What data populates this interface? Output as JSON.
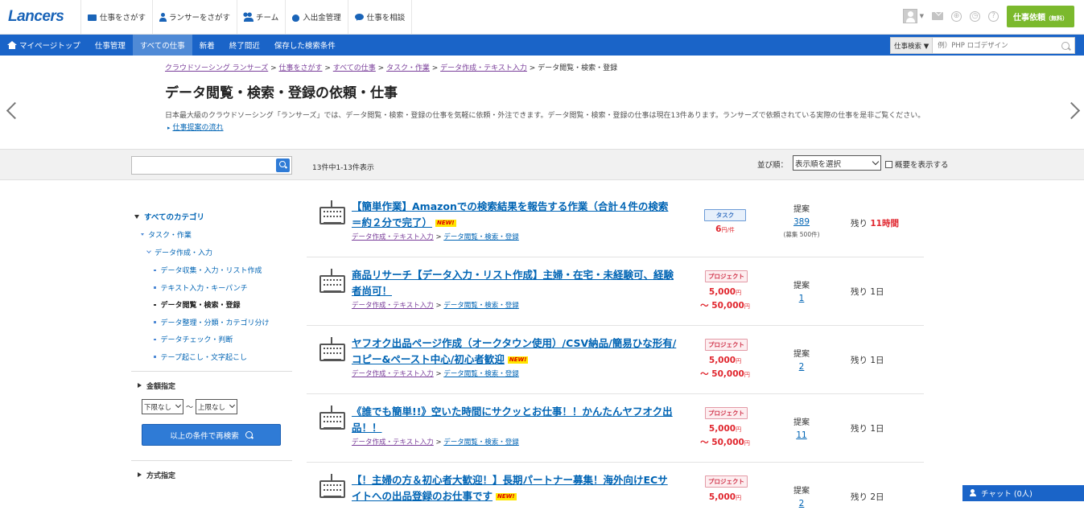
{
  "header": {
    "logo": "Lancers",
    "nav": [
      {
        "label": "仕事をさがす",
        "icon": "folder-icon"
      },
      {
        "label": "ランサーをさがす",
        "icon": "person-icon"
      },
      {
        "label": "チーム",
        "icon": "team-icon"
      },
      {
        "label": "入出金管理",
        "icon": "money-bag-icon"
      },
      {
        "label": "仕事を相談",
        "icon": "chat-bubble-icon"
      }
    ],
    "post_job_label": "仕事依頼",
    "post_job_sub": "（無料）"
  },
  "bluenav": {
    "items": [
      "マイページトップ",
      "仕事管理",
      "すべての仕事",
      "新着",
      "終了間近",
      "保存した検索条件"
    ],
    "search_category": "仕事検索 ▼",
    "search_placeholder": "例）PHP ロゴデザイン"
  },
  "page": {
    "breadcrumb": [
      "クラウドソーシング ランサーズ",
      "仕事をさがす",
      "すべての仕事",
      "タスク・作業",
      "データ作成・テキスト入力",
      "データ閲覧・検索・登録"
    ],
    "title": "データ閲覧・検索・登録の依頼・仕事",
    "description": "日本最大級のクラウドソーシング「ランサーズ」では、データ閲覧・検索・登録の仕事を気軽に依頼・外注できます。データ閲覧・検索・登録の仕事は現在13件あります。ランサーズで依頼されている実際の仕事を是非ご覧ください。",
    "flow_link": "仕事提案の流れ"
  },
  "filter": {
    "count_text": "13件中1-13件表示",
    "sort_label": "並び順：",
    "sort_value": "表示順を選択",
    "summary_label": "概要を表示する"
  },
  "sidebar": {
    "all_categories": "すべてのカテゴリ",
    "level1": "タスク・作業",
    "level2": "データ作成・入力",
    "level3": [
      "データ収集・入力・リスト作成",
      "テキスト入力・キーパンチ",
      "データ閲覧・検索・登録",
      "データ整理・分類・カテゴリ分け",
      "データチェック・判断",
      "テープ起こし・文字起こし"
    ],
    "amount_head": "金額指定",
    "min_value": "下限なし",
    "range_sep": "～",
    "max_value": "上限なし",
    "research_label": "以上の条件で再検索",
    "method_head": "方式指定"
  },
  "jobs": [
    {
      "title": "【簡単作業】Amazonでの検索結果を報告する作業（合計４件の検索＝約２分で完了）",
      "is_new": true,
      "cat1": "データ作成・テキスト入力",
      "cat2": "データ閲覧・検索・登録",
      "type": "タスク",
      "price1": "6",
      "price1_unit": "円/件",
      "price2": "",
      "price2_unit": "",
      "prop_label": "提案",
      "prop_count": "389",
      "prop_cap": "(募集 500件)",
      "remain_prefix": "残り",
      "remain_value": "11時間"
    },
    {
      "title": "商品リサーチ【データ入力・リスト作成】主婦・在宅・未経験可、経験者尚可！",
      "is_new": false,
      "cat1": "データ作成・テキスト入力",
      "cat2": "データ閲覧・検索・登録",
      "type": "プロジェクト",
      "price1": "5,000",
      "price1_unit": "円",
      "price2": "～ 50,000",
      "price2_unit": "円",
      "prop_label": "提案",
      "prop_count": "1",
      "prop_cap": "",
      "remain_prefix": "残り",
      "remain_value": "1日"
    },
    {
      "title": "ヤフオク出品ページ作成（オークタウン使用）/CSV納品/簡易ひな形有/コピー&ペースト中心/初心者歓迎",
      "is_new": true,
      "cat1": "データ作成・テキスト入力",
      "cat2": "データ閲覧・検索・登録",
      "type": "プロジェクト",
      "price1": "5,000",
      "price1_unit": "円",
      "price2": "～ 50,000",
      "price2_unit": "円",
      "prop_label": "提案",
      "prop_count": "2",
      "prop_cap": "",
      "remain_prefix": "残り",
      "remain_value": "1日"
    },
    {
      "title": "《誰でも簡単!!》空いた時間にサクッとお仕事！！かんたんヤフオク出品！！",
      "is_new": false,
      "cat1": "データ作成・テキスト入力",
      "cat2": "データ閲覧・検索・登録",
      "type": "プロジェクト",
      "price1": "5,000",
      "price1_unit": "円",
      "price2": "～ 50,000",
      "price2_unit": "円",
      "prop_label": "提案",
      "prop_count": "11",
      "prop_cap": "",
      "remain_prefix": "残り",
      "remain_value": "1日"
    },
    {
      "title": "【！主婦の方＆初心者大歓迎！】長期パートナー募集！海外向けECサイトへの出品登録のお仕事です",
      "is_new": true,
      "cat1": "",
      "cat2": "",
      "type": "プロジェクト",
      "price1": "5,000",
      "price1_unit": "円",
      "price2": "",
      "price2_unit": "",
      "prop_label": "提案",
      "prop_count": "2",
      "prop_cap": "",
      "remain_prefix": "残り",
      "remain_value": "2日"
    }
  ],
  "new_badge": "NEW!",
  "chat_label": "チャット (0人)",
  "colors": {
    "brand_blue": "#1a64c8",
    "link": "#0064b4",
    "price_red": "#e0262e",
    "green_cta": "#7bb92d"
  }
}
